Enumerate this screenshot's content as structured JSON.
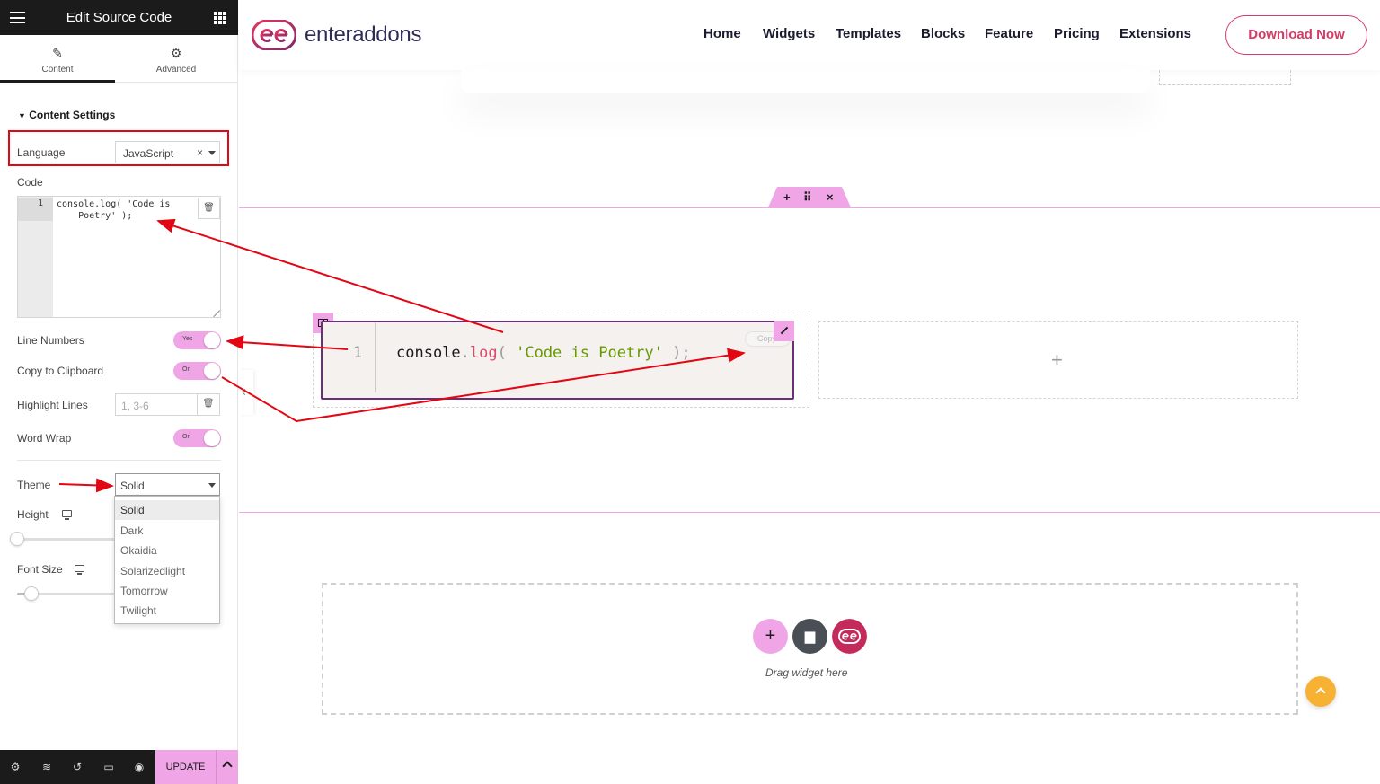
{
  "panel": {
    "title": "Edit Source Code",
    "tabs": [
      {
        "label": "Content",
        "icon": "pencil-icon"
      },
      {
        "label": "Advanced",
        "icon": "gear-icon"
      }
    ],
    "section_title": "Content Settings",
    "language": {
      "label": "Language",
      "value": "JavaScript",
      "clear": "×"
    },
    "code": {
      "label": "Code",
      "line_number": "1",
      "value": "console.log( 'Code is\n    Poetry' );"
    },
    "line_numbers": {
      "label": "Line Numbers",
      "state": "Yes"
    },
    "copy_clipboard": {
      "label": "Copy to Clipboard",
      "state": "On"
    },
    "highlight_lines": {
      "label": "Highlight Lines",
      "placeholder": "1, 3-6"
    },
    "word_wrap": {
      "label": "Word Wrap",
      "state": "On"
    },
    "theme": {
      "label": "Theme",
      "value": "Solid",
      "options": [
        "Solid",
        "Dark",
        "Okaidia",
        "Solarizedlight",
        "Tomorrow",
        "Twilight"
      ]
    },
    "height": {
      "label": "Height"
    },
    "font_size": {
      "label": "Font Size"
    },
    "footer": {
      "update_label": "UPDATE",
      "icons": [
        "gear-icon",
        "layers-icon",
        "history-icon",
        "responsive-icon",
        "eye-icon"
      ]
    }
  },
  "site": {
    "logo_text": "enteraddons",
    "nav": [
      "Home",
      "Widgets",
      "Templates",
      "Blocks",
      "Feature",
      "Pricing",
      "Extensions"
    ],
    "download_label": "Download Now"
  },
  "widget": {
    "line_number": "1",
    "code_parts": {
      "fn": "console",
      "dot": ".",
      "method": "log",
      "open": "( ",
      "str": "'Code is Poetry'",
      "close": " );"
    },
    "copy_label": "Copy"
  },
  "canvas": {
    "drag_text": "Drag widget here",
    "plus": "+"
  },
  "colors": {
    "accent_pink": "#f0a6e6",
    "annotation_red": "#e30613",
    "brand": "#d63a66",
    "widget_border": "#6b2f7a",
    "string_green": "#669900",
    "keyword_pink": "#dd4a68"
  }
}
